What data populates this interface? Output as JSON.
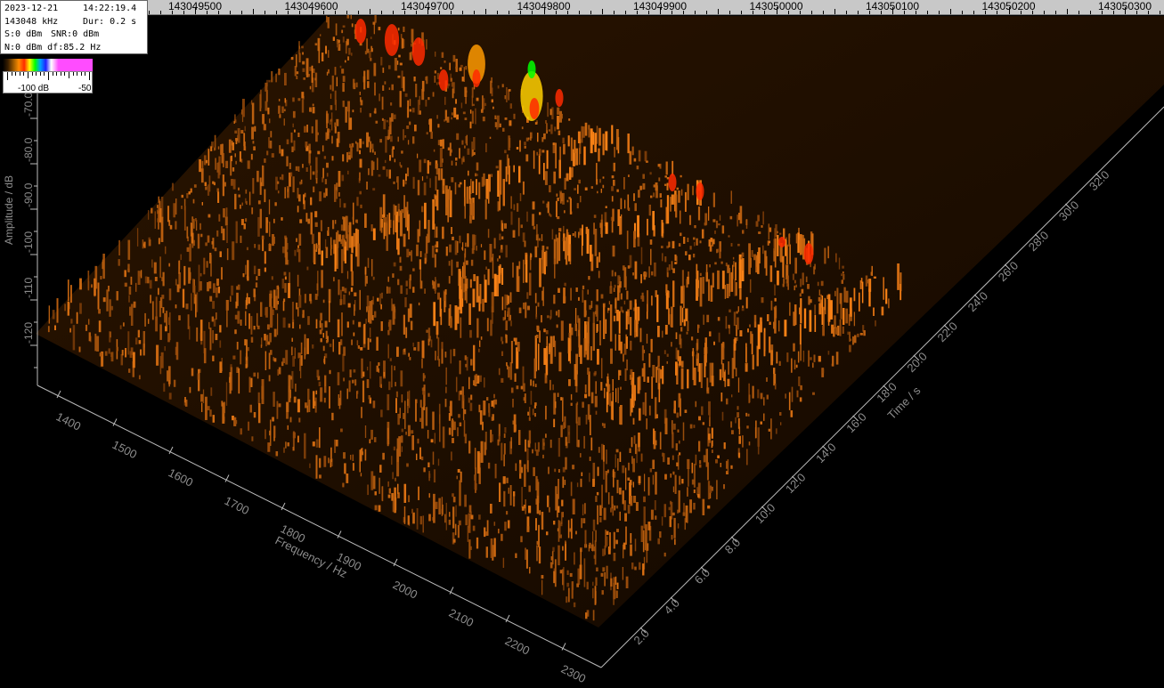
{
  "window": {
    "background": "#000000"
  },
  "top_scale": {
    "labels": [
      "143049500",
      "143049600",
      "143049700",
      "143049800",
      "143049900",
      "143050000",
      "143050100",
      "143050200",
      "143050300"
    ]
  },
  "info_panel": {
    "date": "2023-12-21",
    "time": "14:22:19.4",
    "center_freq": "143048 kHz",
    "duration": "Dur: 0.2 s",
    "signal": "S:0 dBm",
    "snr": "SNR:0 dBm",
    "noise_df": "N:0 dBm df:85.2 Hz"
  },
  "colorbar": {
    "min_label": "-100 dB",
    "max_label": "-50"
  },
  "chart_data": {
    "type": "3d-waterfall",
    "title": "",
    "zlabel": "Amplitude / dB",
    "xlabel": "Frequency / Hz",
    "ylabel": "Time / s",
    "amplitude_ticks": [
      "-70.0",
      "-80.0",
      "-90.0",
      "-100",
      "-110",
      "-120"
    ],
    "frequency_ticks": [
      "1400",
      "1500",
      "1600",
      "1700",
      "1800",
      "1900",
      "2000",
      "2100",
      "2200",
      "2300"
    ],
    "time_ticks": [
      "2.0",
      "4.0",
      "6.0",
      "8.0",
      "10.0",
      "12.0",
      "14.0",
      "16.0",
      "18.0",
      "20.0",
      "22.0",
      "24.0",
      "26.0",
      "28.0",
      "30.0",
      "32.0"
    ],
    "colors": {
      "surface": "#c87010",
      "peak": "#ff2a00",
      "top": "#00ff00"
    }
  }
}
